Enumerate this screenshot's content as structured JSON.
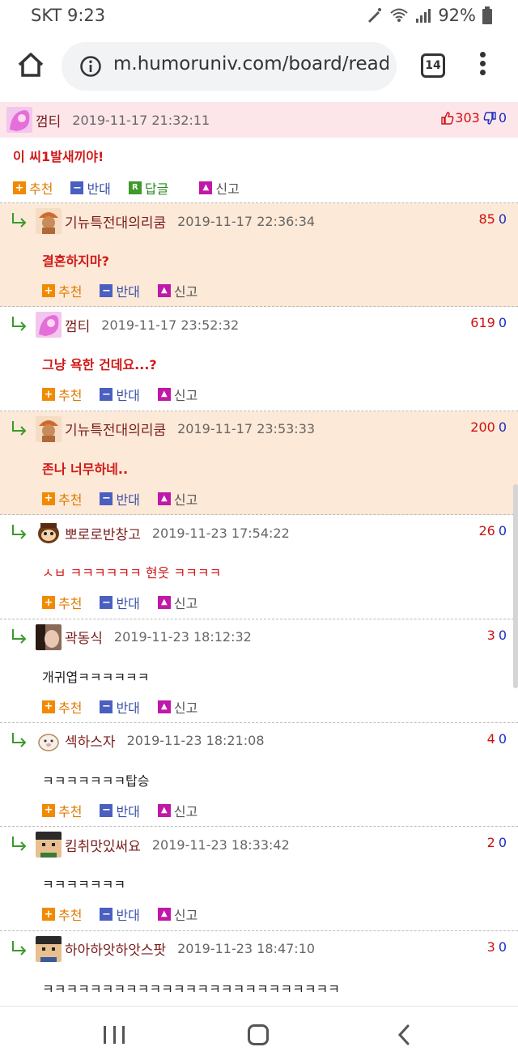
{
  "status": {
    "carrier": "SKT",
    "time": "9:23",
    "battery": "92%"
  },
  "browser": {
    "url": "m.humoruniv.com/board/read.",
    "tab_count": "14"
  },
  "labels": {
    "up": "추천",
    "down": "반대",
    "reply": "답글",
    "report": "신고"
  },
  "colors": {
    "post_header": "#fde6ea",
    "highlight": "#fce9d7",
    "up": "#d01010",
    "down": "#1d2fbf"
  },
  "comments": [
    {
      "user": "껌티",
      "date": "2019-11-17 21:32:11",
      "up": "303",
      "down": "0",
      "text": "이 씨1발새끼야!",
      "text_color": "red"
    },
    {
      "user": "기뉴특전대의리쿰",
      "date": "2019-11-17 22:36:34",
      "up": "85",
      "down": "0",
      "text": "결혼하지마?",
      "text_color": "red"
    },
    {
      "user": "껌티",
      "date": "2019-11-17 23:52:32",
      "up": "619",
      "down": "0",
      "text": "그냥 욕한 건데요...?",
      "text_color": "red"
    },
    {
      "user": "기뉴특전대의리쿰",
      "date": "2019-11-17 23:53:33",
      "up": "200",
      "down": "0",
      "text": "존나 너무하네..",
      "text_color": "red"
    },
    {
      "user": "뽀로로반창고",
      "date": "2019-11-23 17:54:22",
      "up": "26",
      "down": "0",
      "text": "ㅅㅂ ㅋㅋㅋㅋㅋㅋ 현웃 ㅋㅋㅋㅋ",
      "text_color": "red"
    },
    {
      "user": "곽동식",
      "date": "2019-11-23 18:12:32",
      "up": "3",
      "down": "0",
      "text": "개귀엽ㅋㅋㅋㅋㅋㅋ",
      "text_color": "dark"
    },
    {
      "user": "섹하스자",
      "date": "2019-11-23 18:21:08",
      "up": "4",
      "down": "0",
      "text": "ㅋㅋㅋㅋㅋㅋㅋ탑승",
      "text_color": "dark"
    },
    {
      "user": "킴취맛있써요",
      "date": "2019-11-23 18:33:42",
      "up": "2",
      "down": "0",
      "text": "ㅋㅋㅋㅋㅋㅋㅋ",
      "text_color": "dark"
    },
    {
      "user": "하아하앗하앗스팟",
      "date": "2019-11-23 18:47:10",
      "up": "3",
      "down": "0",
      "text": "ㅋㅋㅋㅋㅋㅋㅋㅋㅋㅋㅋㅋㅋㅋㅋㅋㅋㅋㅋㅋㅋㅋㅋㅋㅋ",
      "text_color": "dark"
    }
  ]
}
